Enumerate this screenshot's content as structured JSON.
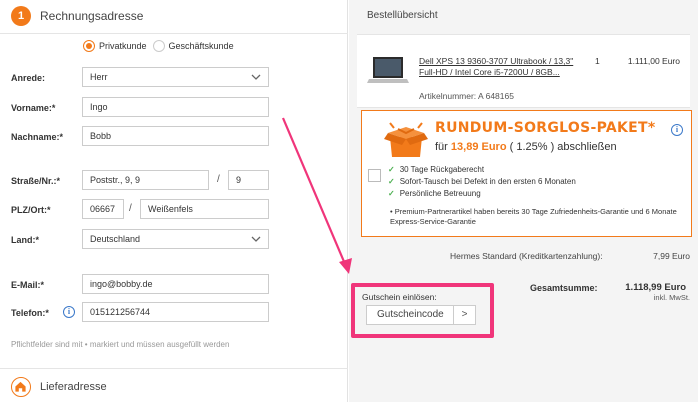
{
  "billing": {
    "step_number": "1",
    "title": "Rechnungsadresse",
    "radio_private": "Privatkunde",
    "radio_business": "Geschäftskunde",
    "labels": {
      "anrede": "Anrede:",
      "vorname": "Vorname:*",
      "nachname": "Nachname:*",
      "strasse": "Straße/Nr.:*",
      "plz_ort": "PLZ/Ort:*",
      "land": "Land:*",
      "email": "E-Mail:*",
      "telefon": "Telefon:*"
    },
    "values": {
      "anrede": "Herr",
      "vorname": "Ingo",
      "nachname": "Bobb",
      "strasse": "Poststr., 9, 9",
      "hausnr": "9",
      "plz": "06667",
      "ort": "Weißenfels",
      "land": "Deutschland",
      "email": "ingo@bobby.de",
      "telefon": "015121256744"
    },
    "slash": "/",
    "footnote": "Pflichtfelder sind mit • markiert und müssen ausgefüllt werden"
  },
  "delivery": {
    "title": "Lieferadresse",
    "icon": "home-icon"
  },
  "order": {
    "title": "Bestellübersicht",
    "product": {
      "name_line1": "Dell XPS 13 9360-3707 Ultrabook / 13,3\"",
      "name_line2": "Full-HD / Intel Core i5-7200U / 8GB...",
      "qty": "1",
      "price": "1.111,00 Euro",
      "article": "Artikelnummer: A 648165"
    },
    "rsp": {
      "title": "RUNDUM-SORGLOS-PAKET*",
      "sub_prefix": "für ",
      "sub_price": "13,89 Euro",
      "sub_suffix": " ( 1.25% ) abschließen",
      "bullets": [
        "30 Tage Rückgaberecht",
        "Sofort-Tausch bei Defekt in den ersten 6 Monaten",
        "Persönliche Betreuung"
      ],
      "note": "• Premium-Partnerartikel haben bereits 30 Tage Zufriedenheits-Garantie und 6 Monate Express-Service-Garantie"
    },
    "shipping_label": "Hermes Standard (Kreditkartenzahlung):",
    "shipping_value": "7,99 Euro",
    "total_label": "Gesamtsumme:",
    "total_value": "1.118,99 Euro",
    "total_sub": "inkl. MwSt.",
    "voucher": {
      "label": "Gutschein einlösen:",
      "placeholder": "Gutscheincode",
      "button": ">"
    }
  },
  "colors": {
    "accent": "#f27a1a",
    "highlight": "#f0357a",
    "info": "#3a78c9",
    "check": "#4caf50"
  }
}
